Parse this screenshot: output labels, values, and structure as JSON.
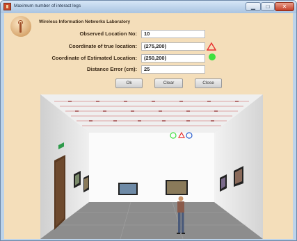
{
  "window": {
    "title": "Maximum number of interact legs"
  },
  "header": {
    "lab_name": "Wireless Information Networks Laboratory"
  },
  "form": {
    "observed_label": "Observed Location No:",
    "observed_value": "10",
    "true_label": "Coordinate of true location:",
    "true_value": "(275,200)",
    "est_label": "Coordinate of Estimated Location:",
    "est_value": "(250,200)",
    "error_label": "Distance Error (cm):",
    "error_value": "25"
  },
  "buttons": {
    "ok": "Ok",
    "clear": "Clear",
    "close": "Close"
  },
  "markers": {
    "true_color": "#e83030",
    "estimated_color": "#3fe03f",
    "observed_color": "#2b5fd0"
  },
  "icons": {
    "app": "app-icon",
    "logo": "antenna-logo-icon",
    "true_marker": "triangle-icon",
    "estimated_marker": "circle-icon"
  }
}
